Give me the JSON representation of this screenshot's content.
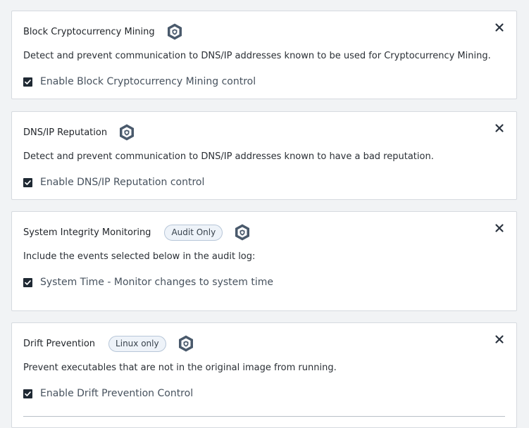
{
  "cards": [
    {
      "title": "Block Cryptocurrency Mining",
      "badge": "",
      "description": "Detect and prevent communication to DNS/IP addresses known to be used for Cryptocurrency Mining.",
      "checkbox": {
        "label": "Enable Block Cryptocurrency Mining control",
        "checked": true
      },
      "close": "×"
    },
    {
      "title": "DNS/IP Reputation",
      "badge": "",
      "description": "Detect and prevent communication to DNS/IP addresses known to have a bad reputation.",
      "checkbox": {
        "label": "Enable DNS/IP Reputation control",
        "checked": true
      },
      "close": "×"
    },
    {
      "title": "System Integrity Monitoring",
      "badge": "Audit Only",
      "description": "Include the events selected below in the audit log:",
      "checkbox": {
        "label": "System Time - Monitor changes to system time",
        "checked": true
      },
      "close": "×"
    },
    {
      "title": "Drift Prevention",
      "badge": "Linux only",
      "description": "Prevent executables that are not in the original image from running.",
      "checkbox": {
        "label": "Enable Drift Prevention Control",
        "checked": true
      },
      "close": "×"
    }
  ],
  "colors": {
    "shield": "#4a5a6c",
    "checkbox": "#1f2933",
    "badge_border": "#b7c6d8",
    "badge_bg": "#eef3f9"
  },
  "icons": {
    "shield": "shield-icon",
    "close": "close-icon",
    "check": "checkmark-icon"
  }
}
